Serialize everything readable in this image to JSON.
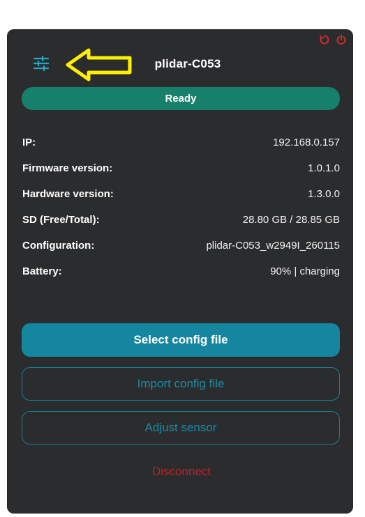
{
  "device": {
    "name": "plidar-C053",
    "status": "Ready"
  },
  "info_rows": [
    {
      "label": "IP:",
      "value": "192.168.0.157"
    },
    {
      "label": "Firmware version:",
      "value": "1.0.1.0"
    },
    {
      "label": "Hardware version:",
      "value": "1.3.0.0"
    },
    {
      "label": "SD (Free/Total):",
      "value": "28.80 GB / 28.85 GB"
    },
    {
      "label": "Configuration:",
      "value": "plidar-C053_w2949I_260115"
    },
    {
      "label": "Battery:",
      "value": "90% | charging"
    }
  ],
  "buttons": {
    "select_config": "Select config file",
    "import_config": "Import config file",
    "adjust_sensor": "Adjust sensor",
    "disconnect": "Disconnect"
  },
  "icons": {
    "settings": "sliders-icon",
    "restart": "restart-icon",
    "power": "power-icon",
    "annotation": "arrow-left-annotation"
  },
  "colors": {
    "panel_bg": "#2b2c2e",
    "status_green": "#17806b",
    "primary_teal": "#1586a0",
    "outline_teal": "#1b7e97",
    "danger_red": "#b3262a",
    "annotation_yellow": "#ffee00"
  }
}
